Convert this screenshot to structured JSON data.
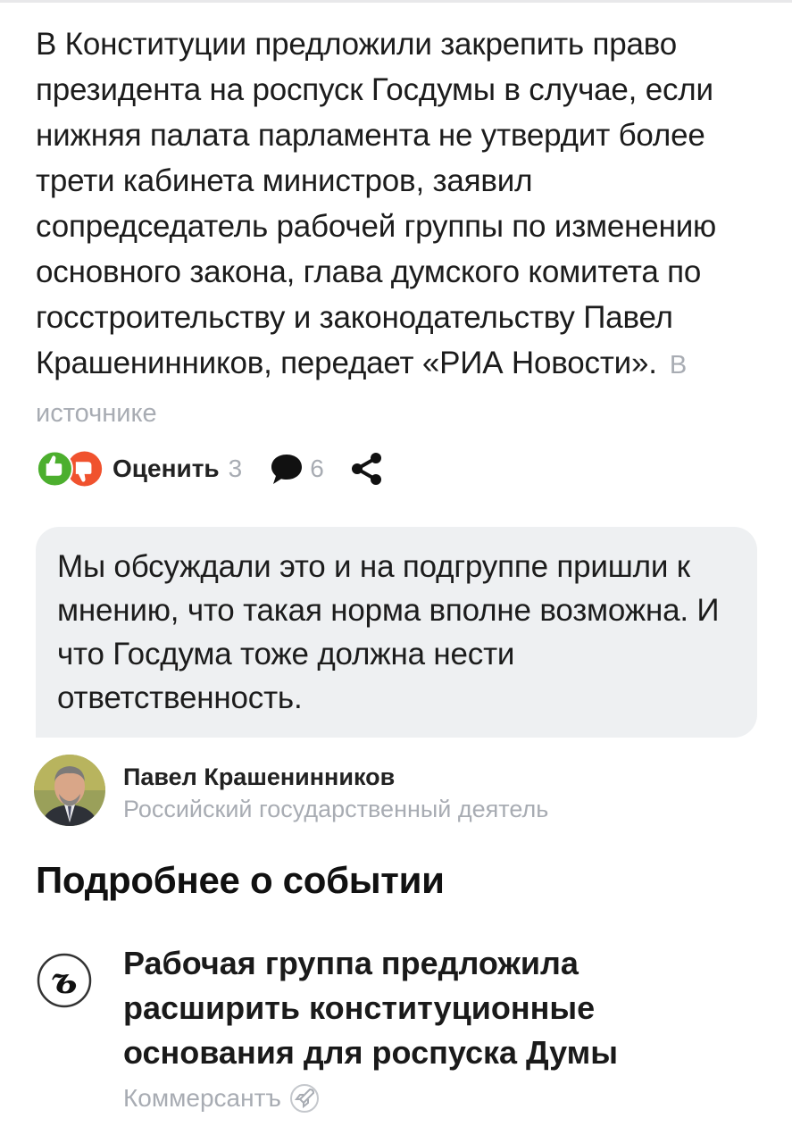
{
  "article": {
    "text": "В Конституции предложили закрепить право президента на роспуск Госдумы в случае, если нижняя палата парламента не утвердит более трети кабинета министров, заявил сопредседатель рабочей группы по изменению основного закона, глава думского комитета по госстроительству и законодательству Павел Крашенинников, передает «РИА Новости».",
    "source_link": "В источнике"
  },
  "actions": {
    "rate_label": "Оценить",
    "rate_count": "3",
    "comment_count": "6",
    "icons": [
      "thumbs-up-icon",
      "thumbs-down-icon",
      "comment-icon",
      "share-icon"
    ],
    "colors": {
      "like": "#4caf2e",
      "dislike": "#f0522e",
      "muted": "#a8acb3"
    }
  },
  "quote": {
    "text": "Мы обсуждали это и на подгруппе пришли к мнению, что такая норма вполне возможна. И что Госдума тоже должна нести ответственность.",
    "background": "#eef0f2"
  },
  "person": {
    "name": "Павел Крашенинников",
    "role": "Российский государственный деятель"
  },
  "related_section": {
    "title": "Подробнее о событии",
    "items": [
      {
        "title": "Рабочая группа предложила расширить конституционные основания для роспуска Думы",
        "source": "Коммерсантъ",
        "logo_icon": "kommersant-logo-icon",
        "badge_icon": "rocket-icon"
      }
    ]
  }
}
